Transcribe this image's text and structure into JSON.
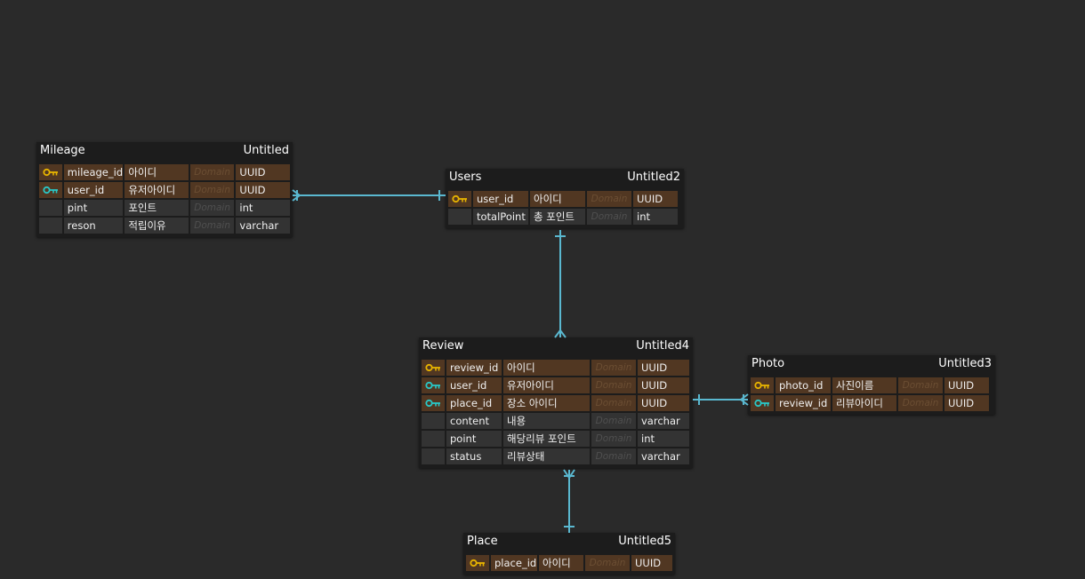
{
  "colors": {
    "background": "#2a2a2a",
    "entity_bg": "#1c1c1c",
    "key_row": "#513722",
    "plain_row": "#333333",
    "primary_key": "#e8b400",
    "foreign_key": "#29c7c7",
    "link": "#5ab8d0"
  },
  "entities": {
    "mileage": {
      "name": "Mileage",
      "label": "Untitled",
      "columns": [
        {
          "icon": "primary-key-icon",
          "name": "mileage_id",
          "logical": "아이디",
          "domain": "Domain",
          "type": "UUID"
        },
        {
          "icon": "foreign-key-icon",
          "name": "user_id",
          "logical": "유저아이디",
          "domain": "Domain",
          "type": "UUID"
        },
        {
          "icon": "",
          "name": "pint",
          "logical": "포인트",
          "domain": "Domain",
          "type": "int"
        },
        {
          "icon": "",
          "name": "reson",
          "logical": "적립이유",
          "domain": "Domain",
          "type": "varchar"
        }
      ]
    },
    "users": {
      "name": "Users",
      "label": "Untitled2",
      "columns": [
        {
          "icon": "primary-key-icon",
          "name": "user_id",
          "logical": "아이디",
          "domain": "Domain",
          "type": "UUID"
        },
        {
          "icon": "",
          "name": "totalPoint",
          "logical": "총 포인트",
          "domain": "Domain",
          "type": "int"
        }
      ]
    },
    "review": {
      "name": "Review",
      "label": "Untitled4",
      "columns": [
        {
          "icon": "primary-key-icon",
          "name": "review_id",
          "logical": "아이디",
          "domain": "Domain",
          "type": "UUID"
        },
        {
          "icon": "foreign-key-icon",
          "name": "user_id",
          "logical": "유저아이디",
          "domain": "Domain",
          "type": "UUID"
        },
        {
          "icon": "foreign-key-icon",
          "name": "place_id",
          "logical": "장소 아이디",
          "domain": "Domain",
          "type": "UUID"
        },
        {
          "icon": "",
          "name": "content",
          "logical": "내용",
          "domain": "Domain",
          "type": "varchar"
        },
        {
          "icon": "",
          "name": "point",
          "logical": "해당리뷰 포인트",
          "domain": "Domain",
          "type": "int"
        },
        {
          "icon": "",
          "name": "status",
          "logical": "리뷰상태",
          "domain": "Domain",
          "type": "varchar"
        }
      ]
    },
    "photo": {
      "name": "Photo",
      "label": "Untitled3",
      "columns": [
        {
          "icon": "primary-key-icon",
          "name": "photo_id",
          "logical": "사진이름",
          "domain": "Domain",
          "type": "UUID"
        },
        {
          "icon": "foreign-key-icon",
          "name": "review_id",
          "logical": "리뷰아이디",
          "domain": "Domain",
          "type": "UUID"
        }
      ]
    },
    "place": {
      "name": "Place",
      "label": "Untitled5",
      "columns": [
        {
          "icon": "primary-key-icon",
          "name": "place_id",
          "logical": "아이디",
          "domain": "Domain",
          "type": "UUID"
        }
      ]
    }
  },
  "relationships": [
    {
      "from": "users",
      "to": "mileage",
      "from_end": "one",
      "to_end": "one-or-many"
    },
    {
      "from": "users",
      "to": "review",
      "from_end": "one",
      "to_end": "many"
    },
    {
      "from": "review",
      "to": "photo",
      "from_end": "one",
      "to_end": "one-or-many"
    },
    {
      "from": "place",
      "to": "review",
      "from_end": "one",
      "to_end": "one-or-many"
    }
  ]
}
